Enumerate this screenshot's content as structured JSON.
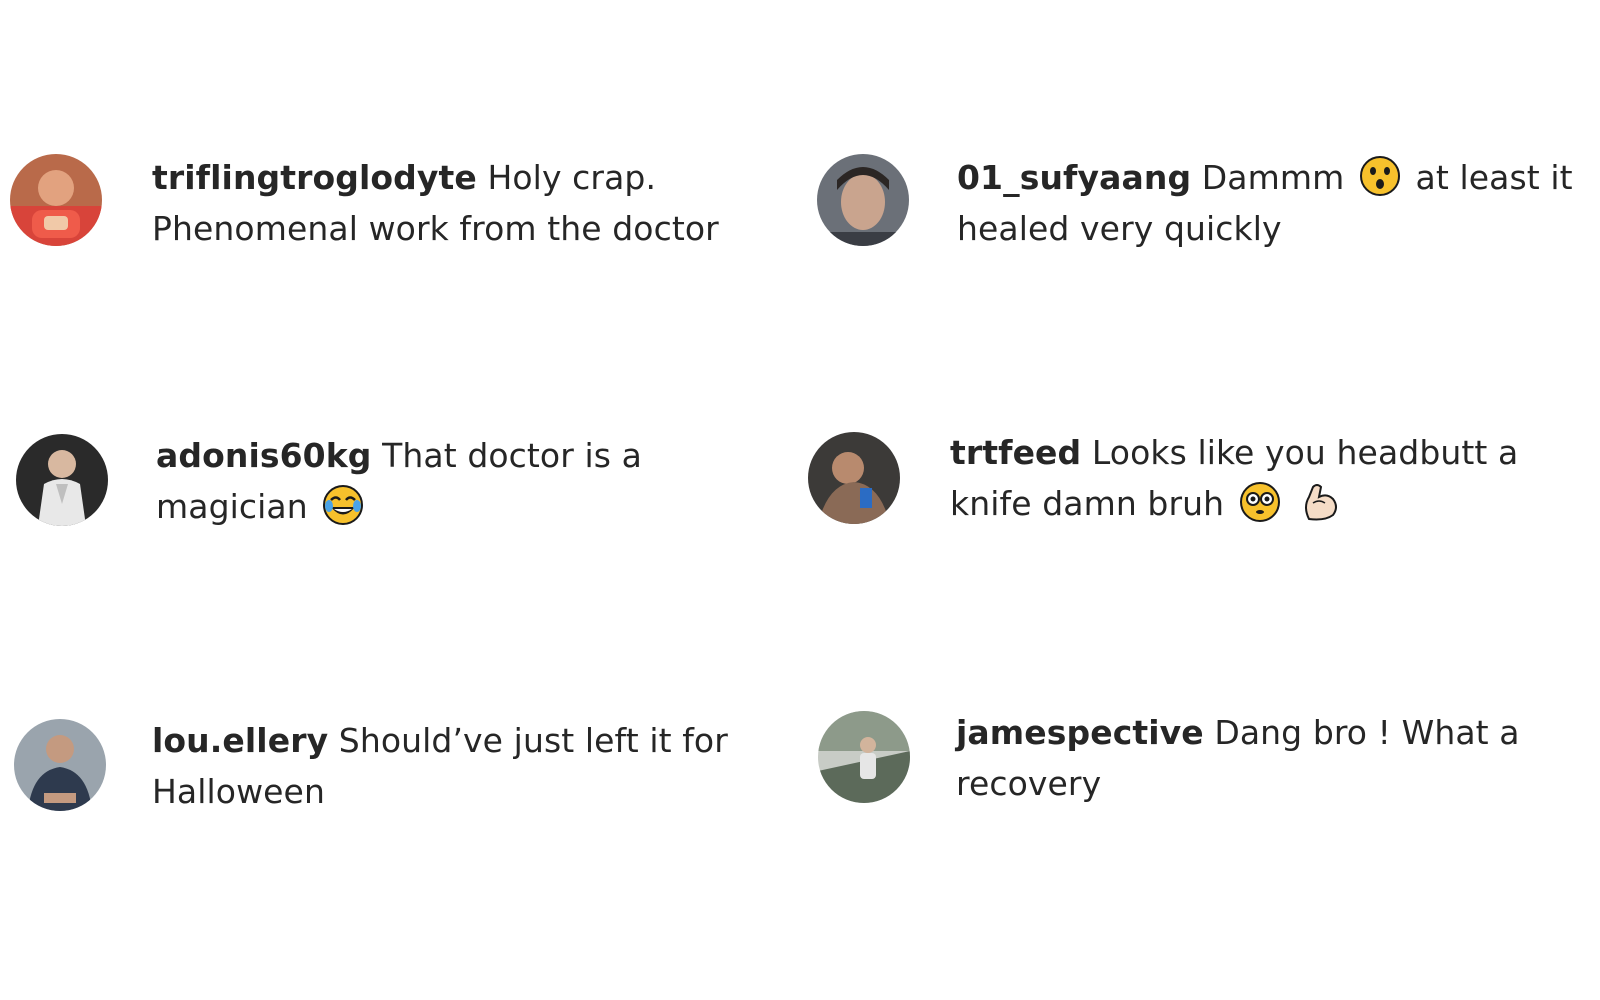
{
  "comments": [
    {
      "username": "triflingtroglodyte",
      "text": "Holy crap. Phenomenal work from the doctor",
      "avatar_icon": "user-avatar-photo"
    },
    {
      "username": "01_sufyaang",
      "text_before": "Dammm",
      "emoji": "astonished-face-emoji",
      "text_after": "at least it healed very quickly",
      "avatar_icon": "user-avatar-photo"
    },
    {
      "username": "adonis60kg",
      "text": "That doctor is a magician",
      "emoji": "tears-of-joy-emoji",
      "avatar_icon": "user-avatar-photo"
    },
    {
      "username": "trtfeed",
      "text": "Looks like you headbutt a knife damn bruh",
      "emojis": [
        "flushed-face-emoji",
        "flexed-biceps-emoji"
      ],
      "avatar_icon": "user-avatar-photo"
    },
    {
      "username": "lou.ellery",
      "text": "Should’ve just left it for Halloween",
      "avatar_icon": "user-avatar-photo"
    },
    {
      "username": "jamespective",
      "text": "Dang bro ! What a recovery",
      "avatar_icon": "user-avatar-photo"
    }
  ],
  "colors": {
    "text": "#262626",
    "background": "#ffffff",
    "emoji_yellow": "#f7c12c"
  }
}
